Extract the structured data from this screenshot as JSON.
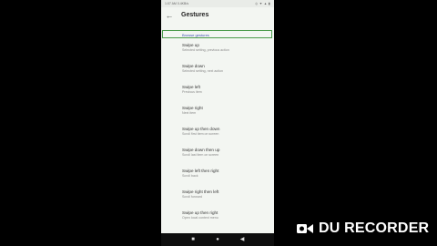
{
  "status_bar": {
    "time": "1:07 AM 0.4KB/s",
    "icons": "◎ ▼ ▲ ▮"
  },
  "app_bar": {
    "back_icon": "arrow-back-icon",
    "title": "Gestures"
  },
  "selected": {
    "label": "Browse gestures"
  },
  "items": [
    {
      "title": "Swipe up",
      "subtitle": "Selected setting, previous action"
    },
    {
      "title": "Swipe down",
      "subtitle": "Selected setting, next action"
    },
    {
      "title": "Swipe left",
      "subtitle": "Previous item"
    },
    {
      "title": "Swipe right",
      "subtitle": "Next item"
    },
    {
      "title": "Swipe up then down",
      "subtitle": "Scroll first item on screen"
    },
    {
      "title": "Swipe down then up",
      "subtitle": "Scroll last item on screen"
    },
    {
      "title": "Swipe left then right",
      "subtitle": "Scroll back"
    },
    {
      "title": "Swipe right then left",
      "subtitle": "Scroll forward"
    },
    {
      "title": "Swipe up then right",
      "subtitle": "Open local context menu"
    }
  ],
  "nav_bar": {
    "menu": "■",
    "home": "●",
    "back": "◀"
  },
  "recorder": {
    "label": "DU RECORDER",
    "icon": "camera-icon",
    "color": "#ffffff"
  }
}
